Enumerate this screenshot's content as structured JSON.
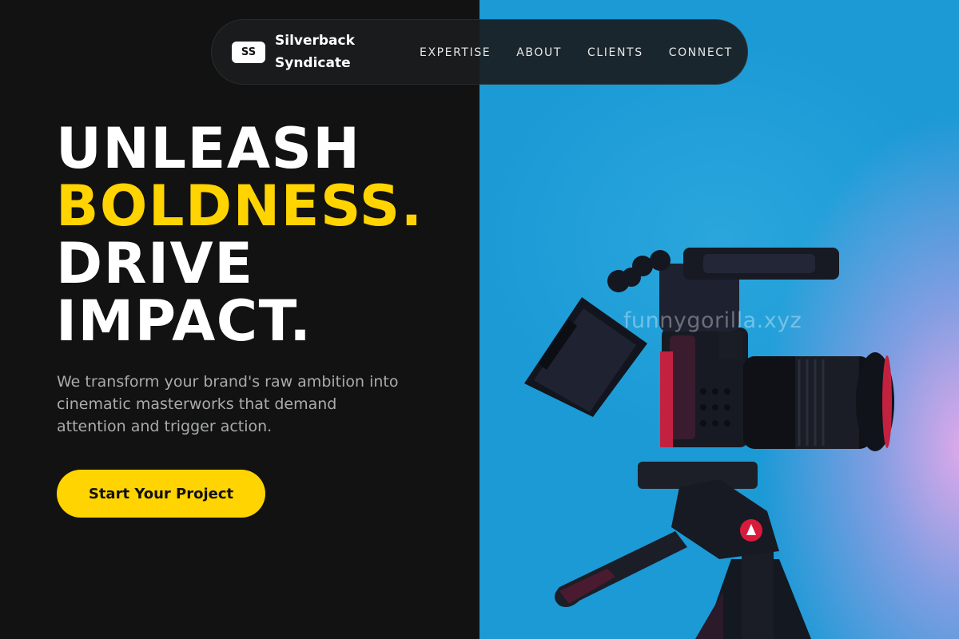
{
  "brand": {
    "badge": "SS",
    "name": "Silverback Syndicate"
  },
  "nav": {
    "items": [
      {
        "label": "EXPERTISE"
      },
      {
        "label": "ABOUT"
      },
      {
        "label": "CLIENTS"
      },
      {
        "label": "CONNECT"
      }
    ]
  },
  "hero": {
    "line1": "UNLEASH",
    "line2": "BOLDNESS.",
    "line3": "DRIVE",
    "line4": "IMPACT.",
    "subtext": "We transform your brand's raw ambition into cinematic masterworks that demand attention and trigger action.",
    "cta_label": "Start Your Project"
  },
  "image": {
    "watermark": "funnygorilla.xyz",
    "subject": "camera-on-tripod-photo"
  },
  "colors": {
    "accent": "#ffd400",
    "background": "#121212",
    "photo_blue": "#1b9ad6",
    "photo_pink": "#e6a8e6"
  }
}
